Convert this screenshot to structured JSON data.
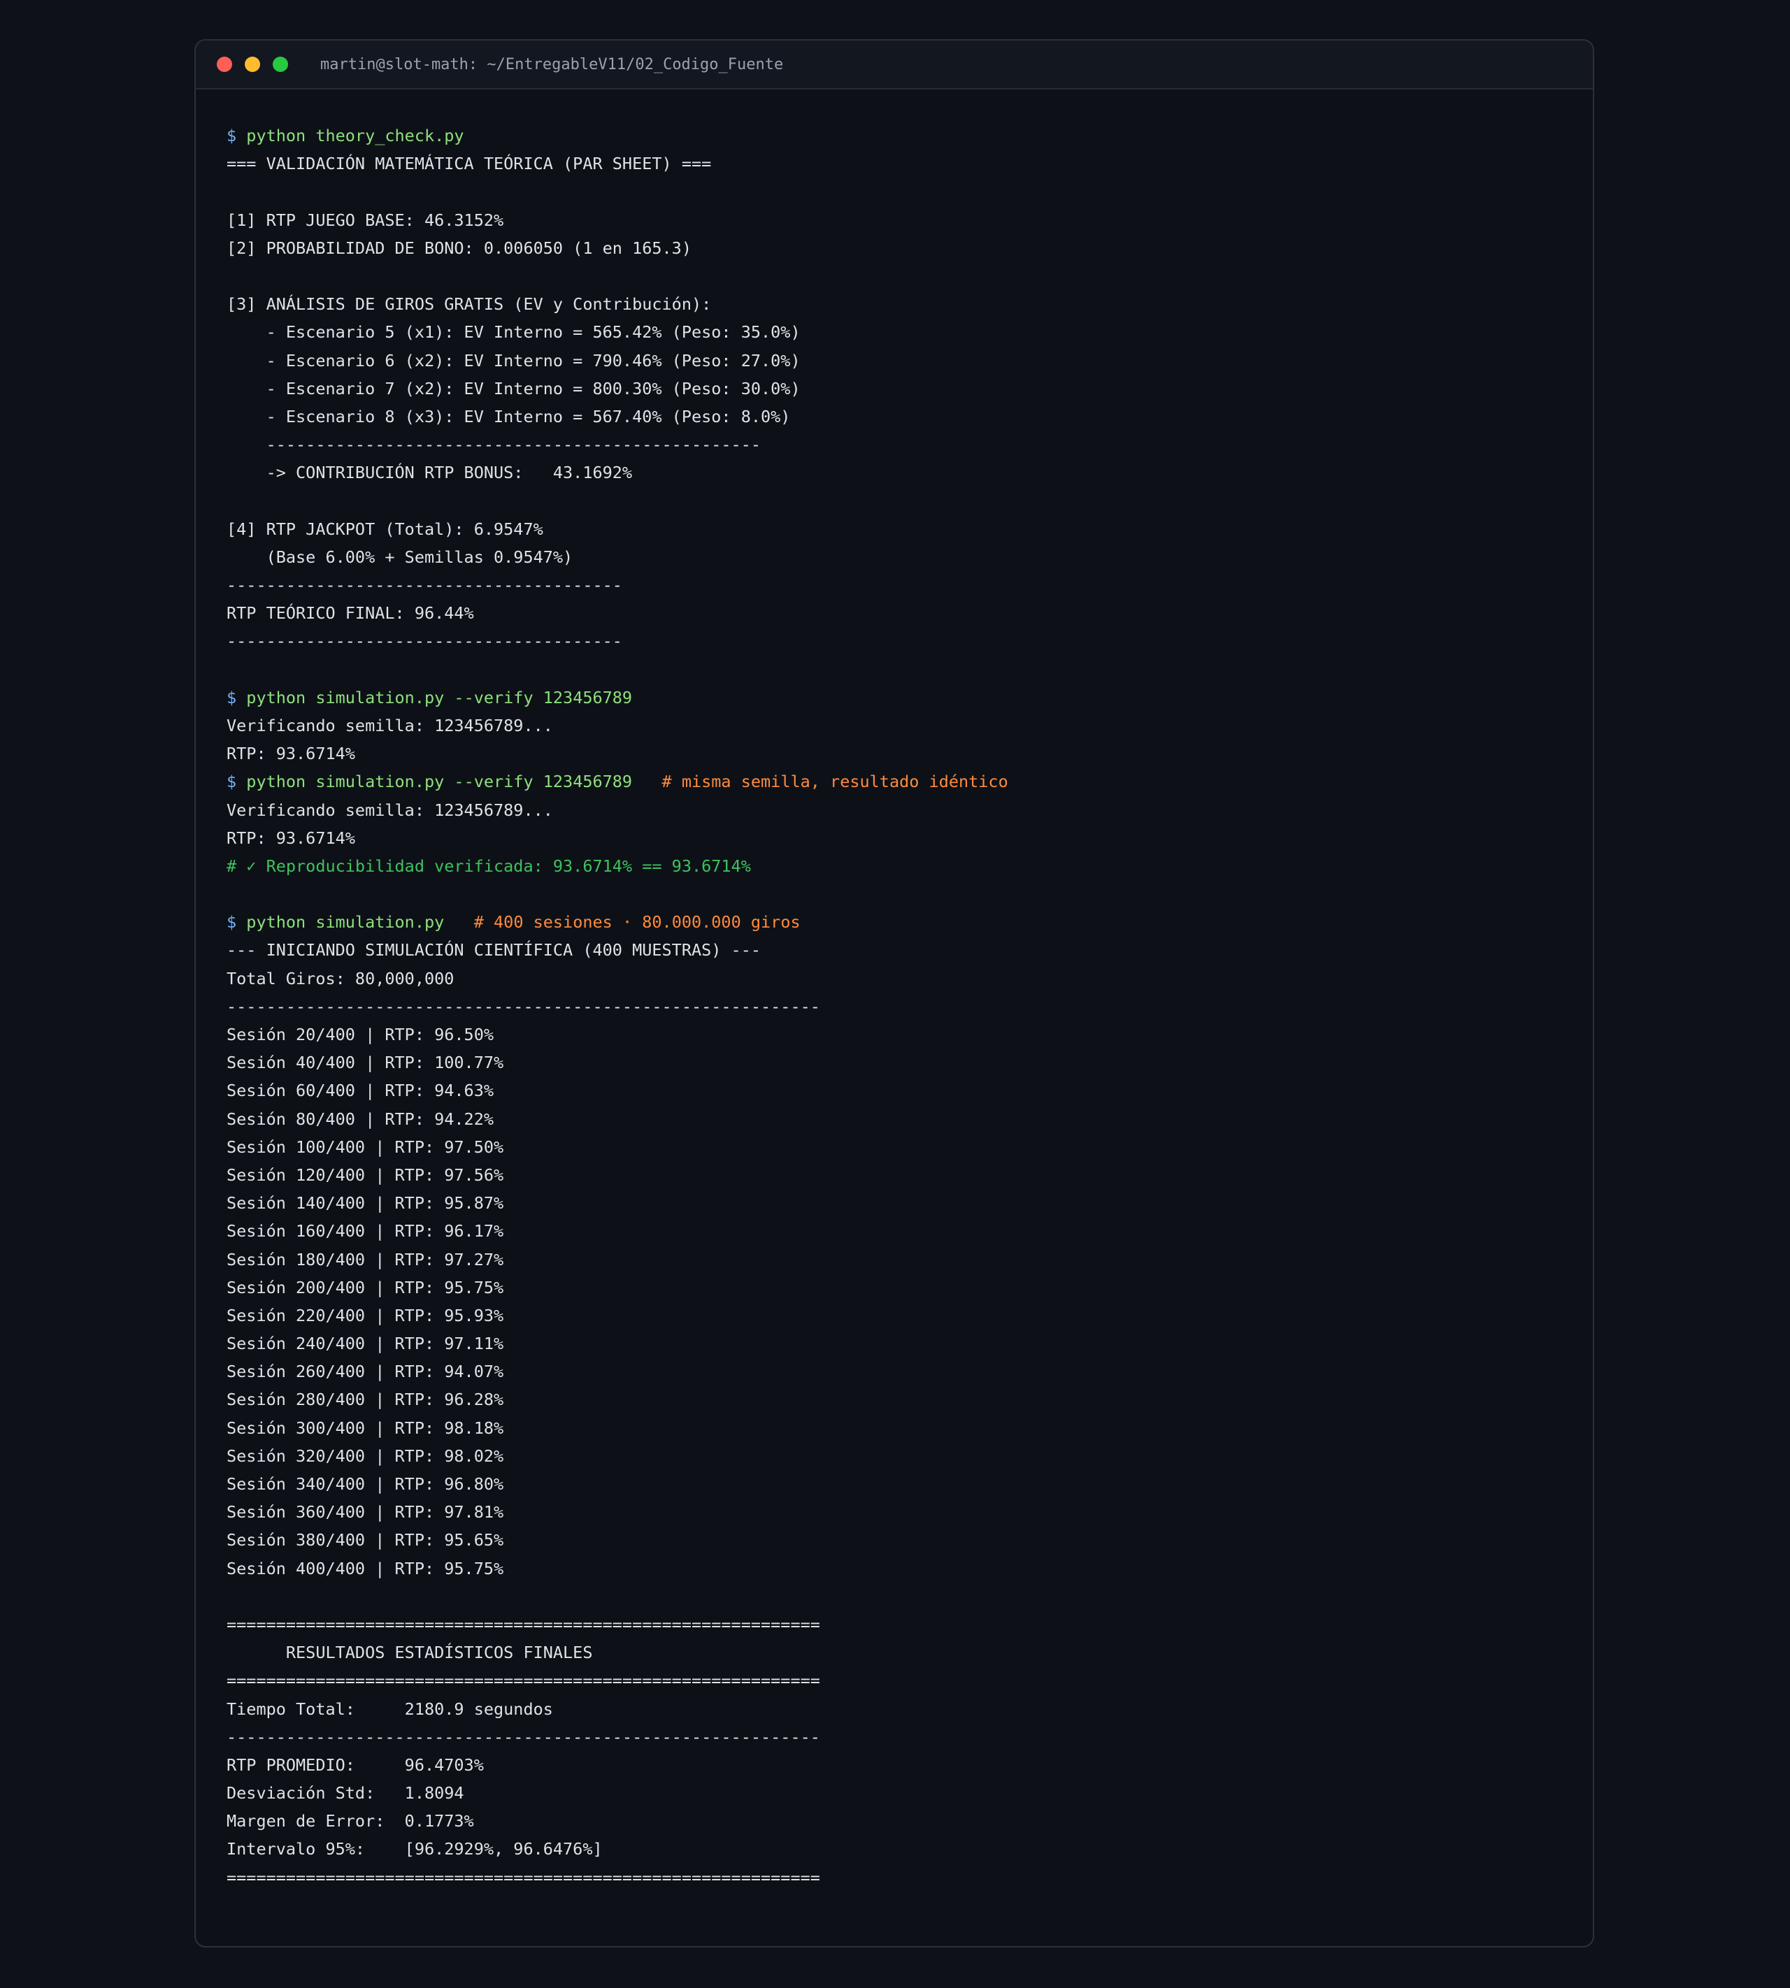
{
  "window": {
    "title": "martin@slot-math: ~/EntregableV11/02_Codigo_Fuente",
    "controls": {
      "close_color": "#ff5f57",
      "minimize_color": "#febc2e",
      "maximize_color": "#28c840"
    }
  },
  "terminal": {
    "prompt_symbol": "$",
    "lines": [
      {
        "kind": "command",
        "cmd": "python theory_check.py",
        "comment": ""
      },
      {
        "kind": "text",
        "text": "=== VALIDACIÓN MATEMÁTICA TEÓRICA (PAR SHEET) ==="
      },
      {
        "kind": "blank"
      },
      {
        "kind": "text",
        "text": "[1] RTP JUEGO BASE: 46.3152%"
      },
      {
        "kind": "text",
        "text": "[2] PROBABILIDAD DE BONO: 0.006050 (1 en 165.3)"
      },
      {
        "kind": "blank"
      },
      {
        "kind": "text",
        "text": "[3] ANÁLISIS DE GIROS GRATIS (EV y Contribución):"
      },
      {
        "kind": "text",
        "text": "    - Escenario 5 (x1): EV Interno = 565.42% (Peso: 35.0%)"
      },
      {
        "kind": "text",
        "text": "    - Escenario 6 (x2): EV Interno = 790.46% (Peso: 27.0%)"
      },
      {
        "kind": "text",
        "text": "    - Escenario 7 (x2): EV Interno = 800.30% (Peso: 30.0%)"
      },
      {
        "kind": "text",
        "text": "    - Escenario 8 (x3): EV Interno = 567.40% (Peso: 8.0%)"
      },
      {
        "kind": "text",
        "text": "    --------------------------------------------------"
      },
      {
        "kind": "text",
        "text": "    -> CONTRIBUCIÓN RTP BONUS:   43.1692%"
      },
      {
        "kind": "blank"
      },
      {
        "kind": "text",
        "text": "[4] RTP JACKPOT (Total): 6.9547%"
      },
      {
        "kind": "text",
        "text": "    (Base 6.00% + Semillas 0.9547%)"
      },
      {
        "kind": "text",
        "text": "----------------------------------------"
      },
      {
        "kind": "text",
        "text": "RTP TEÓRICO FINAL: 96.44%"
      },
      {
        "kind": "text",
        "text": "----------------------------------------"
      },
      {
        "kind": "blank"
      },
      {
        "kind": "command",
        "cmd": "python simulation.py --verify 123456789",
        "comment": ""
      },
      {
        "kind": "text",
        "text": "Verificando semilla: 123456789..."
      },
      {
        "kind": "text",
        "text": "RTP: 93.6714%"
      },
      {
        "kind": "command",
        "cmd": "python simulation.py --verify 123456789",
        "comment": "   # misma semilla, resultado idéntico"
      },
      {
        "kind": "text",
        "text": "Verificando semilla: 123456789..."
      },
      {
        "kind": "text",
        "text": "RTP: 93.6714%"
      },
      {
        "kind": "ok",
        "text": "# ✓ Reproducibilidad verificada: 93.6714% == 93.6714%"
      },
      {
        "kind": "blank"
      },
      {
        "kind": "command",
        "cmd": "python simulation.py",
        "comment": "   # 400 sesiones · 80.000.000 giros"
      },
      {
        "kind": "text",
        "text": "--- INICIANDO SIMULACIÓN CIENTÍFICA (400 MUESTRAS) ---"
      },
      {
        "kind": "text",
        "text": "Total Giros: 80,000,000"
      },
      {
        "kind": "text",
        "text": "------------------------------------------------------------"
      },
      {
        "kind": "text",
        "text": "Sesión 20/400 | RTP: 96.50%"
      },
      {
        "kind": "text",
        "text": "Sesión 40/400 | RTP: 100.77%"
      },
      {
        "kind": "text",
        "text": "Sesión 60/400 | RTP: 94.63%"
      },
      {
        "kind": "text",
        "text": "Sesión 80/400 | RTP: 94.22%"
      },
      {
        "kind": "text",
        "text": "Sesión 100/400 | RTP: 97.50%"
      },
      {
        "kind": "text",
        "text": "Sesión 120/400 | RTP: 97.56%"
      },
      {
        "kind": "text",
        "text": "Sesión 140/400 | RTP: 95.87%"
      },
      {
        "kind": "text",
        "text": "Sesión 160/400 | RTP: 96.17%"
      },
      {
        "kind": "text",
        "text": "Sesión 180/400 | RTP: 97.27%"
      },
      {
        "kind": "text",
        "text": "Sesión 200/400 | RTP: 95.75%"
      },
      {
        "kind": "text",
        "text": "Sesión 220/400 | RTP: 95.93%"
      },
      {
        "kind": "text",
        "text": "Sesión 240/400 | RTP: 97.11%"
      },
      {
        "kind": "text",
        "text": "Sesión 260/400 | RTP: 94.07%"
      },
      {
        "kind": "text",
        "text": "Sesión 280/400 | RTP: 96.28%"
      },
      {
        "kind": "text",
        "text": "Sesión 300/400 | RTP: 98.18%"
      },
      {
        "kind": "text",
        "text": "Sesión 320/400 | RTP: 98.02%"
      },
      {
        "kind": "text",
        "text": "Sesión 340/400 | RTP: 96.80%"
      },
      {
        "kind": "text",
        "text": "Sesión 360/400 | RTP: 97.81%"
      },
      {
        "kind": "text",
        "text": "Sesión 380/400 | RTP: 95.65%"
      },
      {
        "kind": "text",
        "text": "Sesión 400/400 | RTP: 95.75%"
      },
      {
        "kind": "blank"
      },
      {
        "kind": "text",
        "text": "============================================================"
      },
      {
        "kind": "text",
        "text": "      RESULTADOS ESTADÍSTICOS FINALES"
      },
      {
        "kind": "text",
        "text": "============================================================"
      },
      {
        "kind": "text",
        "text": "Tiempo Total:     2180.9 segundos"
      },
      {
        "kind": "text",
        "text": "------------------------------------------------------------"
      },
      {
        "kind": "text",
        "text": "RTP PROMEDIO:     96.4703%"
      },
      {
        "kind": "text",
        "text": "Desviación Std:   1.8094"
      },
      {
        "kind": "text",
        "text": "Margen de Error:  0.1773%"
      },
      {
        "kind": "text",
        "text": "Intervalo 95%:    [96.2929%, 96.6476%]"
      },
      {
        "kind": "text",
        "text": "============================================================"
      }
    ]
  }
}
